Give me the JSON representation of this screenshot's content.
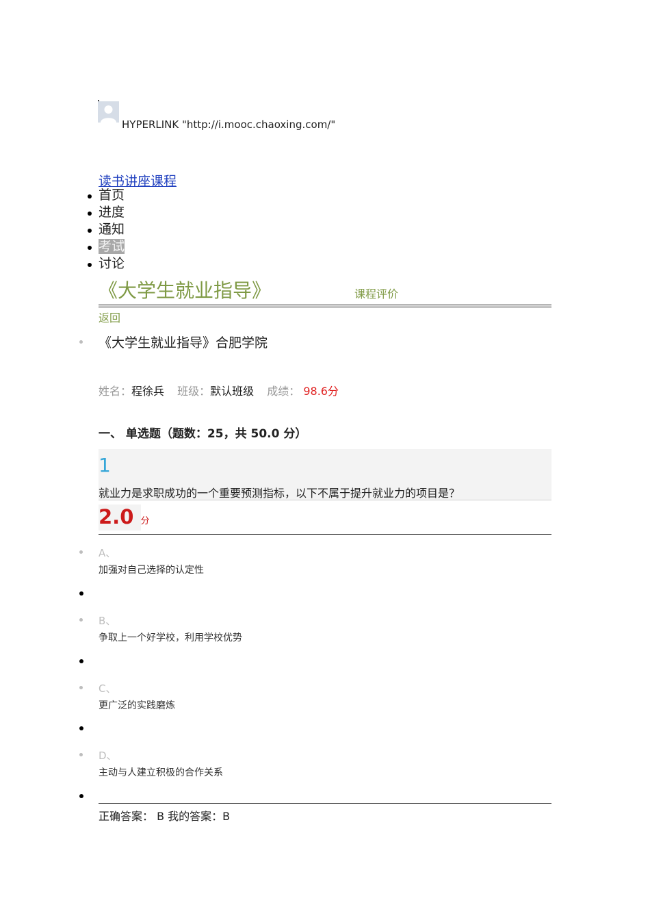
{
  "header": {
    "avatar_icon": "user-avatar-icon",
    "hyperlink_text": "HYPERLINK \"http://i.mooc.chaoxing.com/\"",
    "course_link": "读书讲座课程"
  },
  "nav": {
    "items": [
      {
        "label": "首页"
      },
      {
        "label": "进度"
      },
      {
        "label": "通知"
      },
      {
        "label": "考试",
        "active": true
      },
      {
        "label": "讨论"
      }
    ]
  },
  "course": {
    "title": "《大学生就业指导》",
    "review_label": "课程评价",
    "back_label": "返回"
  },
  "exam": {
    "title": "《大学生就业指导》合肥学院",
    "name_label": "姓名：",
    "name_value": "程徐兵",
    "class_label": "班级：",
    "class_value": "默认班级",
    "score_label": "成绩：",
    "score_value": "98.6分"
  },
  "section": {
    "heading": "一、 单选题（题数：25，共 50.0 分）"
  },
  "question": {
    "number": "1",
    "text": "就业力是求职成功的一个重要预测指标，以下不属于提升就业力的项目是？",
    "points": "2.0",
    "points_unit": "分",
    "options": [
      {
        "letter": "A、",
        "text": "加强对自己选择的认定性"
      },
      {
        "letter": "B、",
        "text": "争取上一个好学校，利用学校优势"
      },
      {
        "letter": "C、",
        "text": "更广泛的实践磨炼"
      },
      {
        "letter": "D、",
        "text": "主动与人建立积极的合作关系"
      }
    ],
    "answer_line": "正确答案： B 我的答案：B"
  },
  "colors": {
    "course_green": "#7f9a45",
    "score_red": "#e02020",
    "number_blue": "#35a6d8",
    "points_red": "#cc1a1a",
    "link_blue": "#1f3fbf"
  }
}
